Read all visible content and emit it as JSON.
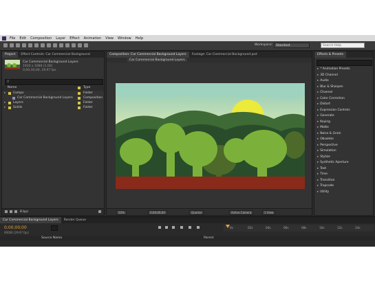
{
  "menu": {
    "items": [
      "File",
      "Edit",
      "Composition",
      "Layer",
      "Effect",
      "Animation",
      "View",
      "Window",
      "Help"
    ]
  },
  "toolbar": {
    "workspace_label": "Workspace:",
    "workspace_value": "Standard",
    "search_placeholder": "Search Help"
  },
  "project_panel": {
    "tabs": [
      "Project",
      "Effect Controls: Car Commercial Background"
    ],
    "selected_item_name": "Car Commercial Background Layers",
    "selected_item_size": "1920 x 1080 (1.00)",
    "selected_item_duration": "0;00;30;00, 29.97 fps",
    "search_placeholder": "",
    "columns": {
      "name": "Name",
      "type": "Type"
    },
    "rows": [
      {
        "name": "Comps",
        "type": "Folder",
        "indent": 0,
        "color": "#d6c44a"
      },
      {
        "name": "Car Commercial Background Layers",
        "type": "Composition",
        "indent": 1,
        "color": "#d6c44a"
      },
      {
        "name": "Layers",
        "type": "Folder",
        "indent": 0,
        "color": "#d6c44a"
      },
      {
        "name": "Solids",
        "type": "Folder",
        "indent": 0,
        "color": "#d6c44a"
      }
    ],
    "bpc": "8 bpc"
  },
  "comp_panel": {
    "tabs": [
      "Composition: Car Commercial Background Layers",
      "Footage: Car Commercial Background.psd"
    ],
    "subtab": "Car Commercial Background Layers",
    "zoom": "50%",
    "timecode": "0;00;00;00",
    "resolution": "Quarter",
    "camera": "Active Camera",
    "views": "1 View"
  },
  "effects_panel": {
    "title": "Effects & Presets",
    "search_placeholder": "",
    "items": [
      "* Animation Presets",
      "3D Channel",
      "Audio",
      "Blur & Sharpen",
      "Channel",
      "Color Correction",
      "Distort",
      "Expression Controls",
      "Generate",
      "Keying",
      "Matte",
      "Noise & Grain",
      "Obsolete",
      "Perspective",
      "Simulation",
      "Stylize",
      "Synthetic Aperture",
      "Text",
      "Time",
      "Transition",
      "Trapcode",
      "Utility"
    ]
  },
  "timeline": {
    "tabs": [
      "Car Commercial Background Layers",
      "Render Queue"
    ],
    "timecode": "0;00;00;00",
    "frame_info": "00000 (29.97 fps)",
    "ruler": [
      "0s",
      "02s",
      "04s",
      "06s",
      "08s",
      "10s",
      "12s",
      "14s"
    ],
    "columns": {
      "source": "Source Name",
      "parent": "Parent"
    }
  },
  "colors": {
    "sky_top": "#8fcbb8",
    "sky_bottom": "#e9ecb3",
    "sun": "#ecea3a",
    "hill_far": "#3e6a36",
    "hill_near": "#294d2a",
    "tree_light": "#7bb13a",
    "tree_dark": "#4d6a2a",
    "ground": "#8a2a1a",
    "accent_orange": "#e7a23a"
  }
}
